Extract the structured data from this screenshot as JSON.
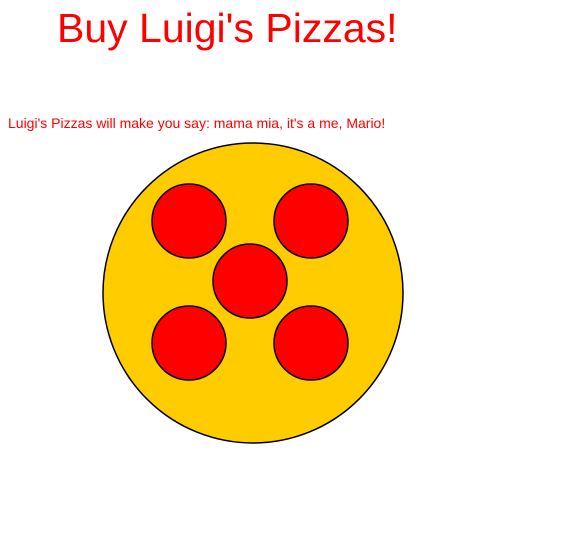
{
  "header": {
    "title": "Buy Luigi's Pizzas!"
  },
  "content": {
    "tagline": "Luigi's Pizzas will make you say: mama mia, it's a me, Mario!"
  },
  "pizza": {
    "topping_count": 5
  },
  "colors": {
    "text": "#ff0000",
    "crust": "#ffcc00",
    "pepperoni": "#ff0000",
    "outline": "#000000"
  }
}
